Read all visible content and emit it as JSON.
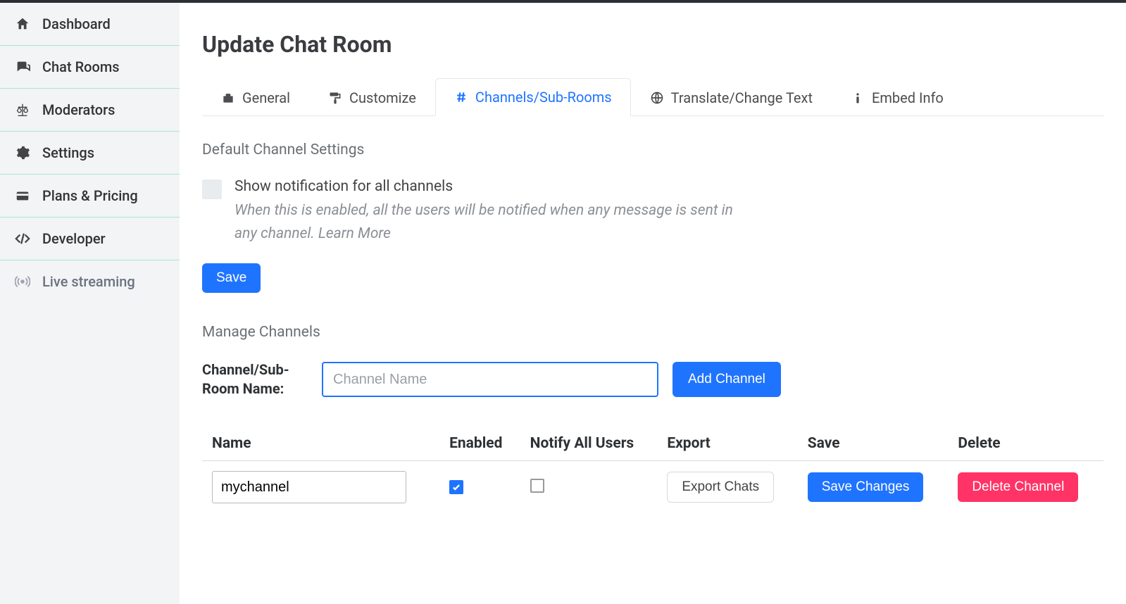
{
  "sidebar": {
    "items": [
      {
        "label": "Dashboard"
      },
      {
        "label": "Chat Rooms"
      },
      {
        "label": "Moderators"
      },
      {
        "label": "Settings"
      },
      {
        "label": "Plans & Pricing"
      },
      {
        "label": "Developer"
      },
      {
        "label": "Live streaming"
      }
    ]
  },
  "page": {
    "title": "Update Chat Room"
  },
  "tabs": {
    "general": "General",
    "customize": "Customize",
    "channels": "Channels/Sub-Rooms",
    "translate": "Translate/Change Text",
    "embed": "Embed Info"
  },
  "defaultSettings": {
    "heading": "Default Channel Settings",
    "notifyLabel": "Show notification for all channels",
    "notifyDesc": "When this is enabled, all the users will be notified when any message is sent in any channel. Learn More",
    "saveLabel": "Save"
  },
  "manage": {
    "heading": "Manage Channels",
    "fieldLabel": "Channel/Sub-Room Name:",
    "placeholder": "Channel Name",
    "addLabel": "Add Channel"
  },
  "table": {
    "headers": {
      "name": "Name",
      "enabled": "Enabled",
      "notify": "Notify All Users",
      "export": "Export",
      "save": "Save",
      "delete": "Delete"
    },
    "rows": [
      {
        "name": "mychannel",
        "enabled": true,
        "notify": false,
        "exportLabel": "Export Chats",
        "saveLabel": "Save Changes",
        "deleteLabel": "Delete Channel"
      }
    ]
  }
}
